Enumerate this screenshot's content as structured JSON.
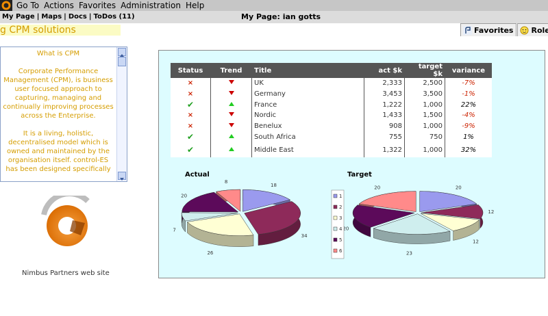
{
  "menu": {
    "items": [
      "Go To",
      "Actions",
      "Favorites",
      "Administration",
      "Help"
    ]
  },
  "nav": {
    "links": [
      "My Page",
      "Maps",
      "Docs",
      "ToDos (11)"
    ],
    "page_label": "My Page: ian gotts"
  },
  "banner": {
    "text": "g CPM solutions"
  },
  "tabs": [
    {
      "label": "Favorites",
      "icon": "favorites-icon"
    },
    {
      "label": "Roles",
      "icon": "roles-icon"
    }
  ],
  "info": {
    "title": "What is CPM",
    "paragraphs": [
      "Corporate Performance Management (CPM), is business user focused approach to capturing, managing and continually improving processes across the Enterprise.",
      "It is a living, holistic, decentralised model which is owned and maintained by the organisation itself. control-ES has been designed specifically"
    ]
  },
  "nimbus": {
    "link": "Nimbus Partners web site"
  },
  "table": {
    "headers": [
      "Status",
      "Trend",
      "Title",
      "act $k",
      "target $k",
      "variance"
    ],
    "rows": [
      {
        "status": "cross",
        "trend": "down",
        "title": "UK",
        "act": "2,333",
        "target": "2,500",
        "variance": "-7%"
      },
      {
        "status": "cross",
        "trend": "down",
        "title": "Germany",
        "act": "3,453",
        "target": "3,500",
        "variance": "-1%"
      },
      {
        "status": "tick",
        "trend": "up",
        "title": "France",
        "act": "1,222",
        "target": "1,000",
        "variance": "22%"
      },
      {
        "status": "cross",
        "trend": "down",
        "title": "Nordic",
        "act": "1,433",
        "target": "1,500",
        "variance": "-4%"
      },
      {
        "status": "cross",
        "trend": "down",
        "title": "Benelux",
        "act": "908",
        "target": "1,000",
        "variance": "-9%"
      },
      {
        "status": "tick",
        "trend": "up",
        "title": "South Africa",
        "act": "755",
        "target": "750",
        "variance": "1%"
      },
      {
        "status": "tick",
        "trend": "up",
        "title": "Middle East",
        "act": "1,322",
        "target": "1,000",
        "variance": "32%"
      }
    ],
    "colors": {
      "negative": "#cc2200",
      "positive": "#000000",
      "cross": "#cc2200",
      "tick": "#22a022",
      "down": "#cc0000",
      "up": "#22cc22"
    }
  },
  "chart_data": [
    {
      "type": "pie",
      "title": "Actual",
      "categories": [
        "1",
        "2",
        "3",
        "4",
        "5",
        "6"
      ],
      "values": [
        18,
        34,
        26,
        7,
        20,
        8
      ],
      "colors": [
        "#9a9aee",
        "#8e2a5a",
        "#ffffd4",
        "#cfeeee",
        "#5c0a5a",
        "#ff8a8a"
      ]
    },
    {
      "type": "pie",
      "title": "Target",
      "categories": [
        "1",
        "2",
        "3",
        "4",
        "5",
        "6"
      ],
      "values": [
        20,
        12,
        12,
        23,
        20,
        20
      ],
      "colors": [
        "#9a9aee",
        "#8e2a5a",
        "#ffffd4",
        "#cfeeee",
        "#5c0a5a",
        "#ff8a8a"
      ],
      "legend": "left"
    }
  ]
}
